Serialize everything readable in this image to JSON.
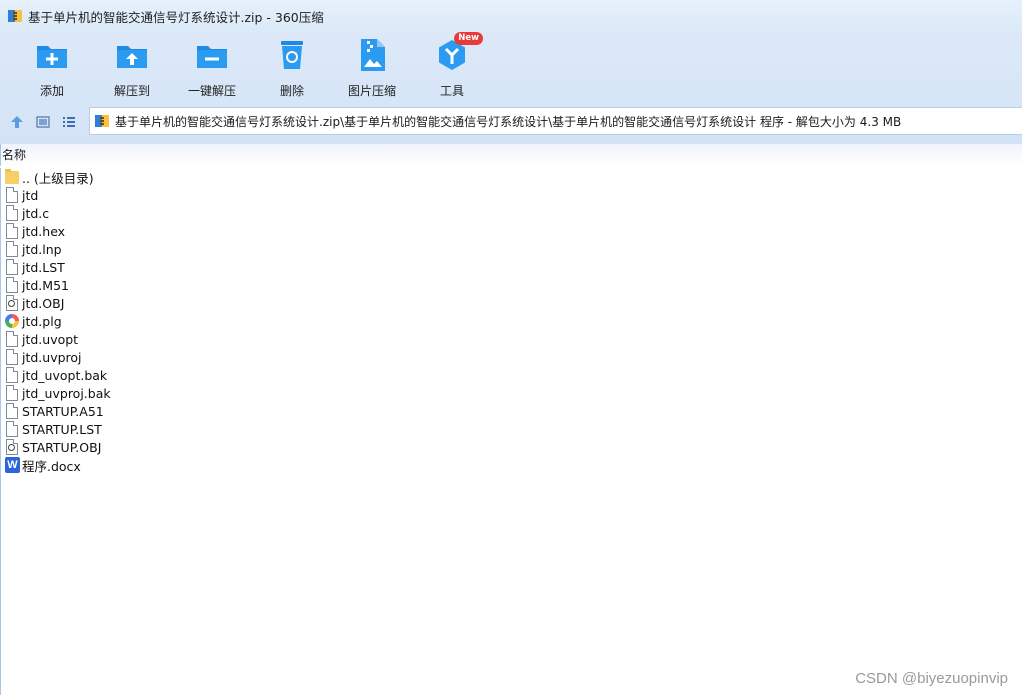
{
  "window": {
    "title": "基于单片机的智能交通信号灯系统设计.zip - 360压缩"
  },
  "toolbar": {
    "buttons": [
      {
        "label": "添加",
        "icon": "add-folder-icon"
      },
      {
        "label": "解压到",
        "icon": "extract-to-icon"
      },
      {
        "label": "一键解压",
        "icon": "one-click-extract-icon"
      },
      {
        "label": "删除",
        "icon": "recycle-delete-icon"
      },
      {
        "label": "图片压缩",
        "icon": "image-compress-icon"
      },
      {
        "label": "工具",
        "icon": "tools-icon",
        "badge": "New"
      }
    ]
  },
  "nav": {
    "address": "基于单片机的智能交通信号灯系统设计.zip\\基于单片机的智能交通信号灯系统设计\\基于单片机的智能交通信号灯系统设计 程序 - 解包大小为 4.3 MB"
  },
  "list": {
    "column_name": "名称",
    "files": [
      {
        "name": ".. (上级目录)",
        "icon": "parent-folder-icon"
      },
      {
        "name": "jtd",
        "icon": "file-icon"
      },
      {
        "name": "jtd.c",
        "icon": "file-icon"
      },
      {
        "name": "jtd.hex",
        "icon": "file-icon"
      },
      {
        "name": "jtd.lnp",
        "icon": "file-icon"
      },
      {
        "name": "jtd.LST",
        "icon": "file-icon"
      },
      {
        "name": "jtd.M51",
        "icon": "file-icon"
      },
      {
        "name": "jtd.OBJ",
        "icon": "obj-file-icon"
      },
      {
        "name": "jtd.plg",
        "icon": "plg-file-icon"
      },
      {
        "name": "jtd.uvopt",
        "icon": "file-icon"
      },
      {
        "name": "jtd.uvproj",
        "icon": "file-icon"
      },
      {
        "name": "jtd_uvopt.bak",
        "icon": "file-icon"
      },
      {
        "name": "jtd_uvproj.bak",
        "icon": "file-icon"
      },
      {
        "name": "STARTUP.A51",
        "icon": "file-icon"
      },
      {
        "name": "STARTUP.LST",
        "icon": "file-icon"
      },
      {
        "name": "STARTUP.OBJ",
        "icon": "obj-file-icon"
      },
      {
        "name": "程序.docx",
        "icon": "word-file-icon"
      }
    ]
  },
  "watermark": "CSDN @biyezuopinvip",
  "colors": {
    "accent_blue": "#1e8be0",
    "toolbar_bg": "#dde9f8",
    "word_blue": "#2b65d9",
    "badge_red": "#e83a3a"
  }
}
